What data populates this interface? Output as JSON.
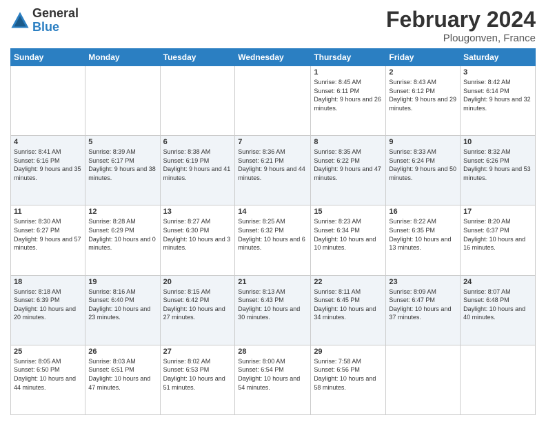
{
  "logo": {
    "general": "General",
    "blue": "Blue"
  },
  "title": {
    "month_year": "February 2024",
    "location": "Plougonven, France"
  },
  "days_header": [
    "Sunday",
    "Monday",
    "Tuesday",
    "Wednesday",
    "Thursday",
    "Friday",
    "Saturday"
  ],
  "weeks": [
    [
      {
        "day": "",
        "info": ""
      },
      {
        "day": "",
        "info": ""
      },
      {
        "day": "",
        "info": ""
      },
      {
        "day": "",
        "info": ""
      },
      {
        "day": "1",
        "info": "Sunrise: 8:45 AM\nSunset: 6:11 PM\nDaylight: 9 hours and 26 minutes."
      },
      {
        "day": "2",
        "info": "Sunrise: 8:43 AM\nSunset: 6:12 PM\nDaylight: 9 hours and 29 minutes."
      },
      {
        "day": "3",
        "info": "Sunrise: 8:42 AM\nSunset: 6:14 PM\nDaylight: 9 hours and 32 minutes."
      }
    ],
    [
      {
        "day": "4",
        "info": "Sunrise: 8:41 AM\nSunset: 6:16 PM\nDaylight: 9 hours and 35 minutes."
      },
      {
        "day": "5",
        "info": "Sunrise: 8:39 AM\nSunset: 6:17 PM\nDaylight: 9 hours and 38 minutes."
      },
      {
        "day": "6",
        "info": "Sunrise: 8:38 AM\nSunset: 6:19 PM\nDaylight: 9 hours and 41 minutes."
      },
      {
        "day": "7",
        "info": "Sunrise: 8:36 AM\nSunset: 6:21 PM\nDaylight: 9 hours and 44 minutes."
      },
      {
        "day": "8",
        "info": "Sunrise: 8:35 AM\nSunset: 6:22 PM\nDaylight: 9 hours and 47 minutes."
      },
      {
        "day": "9",
        "info": "Sunrise: 8:33 AM\nSunset: 6:24 PM\nDaylight: 9 hours and 50 minutes."
      },
      {
        "day": "10",
        "info": "Sunrise: 8:32 AM\nSunset: 6:26 PM\nDaylight: 9 hours and 53 minutes."
      }
    ],
    [
      {
        "day": "11",
        "info": "Sunrise: 8:30 AM\nSunset: 6:27 PM\nDaylight: 9 hours and 57 minutes."
      },
      {
        "day": "12",
        "info": "Sunrise: 8:28 AM\nSunset: 6:29 PM\nDaylight: 10 hours and 0 minutes."
      },
      {
        "day": "13",
        "info": "Sunrise: 8:27 AM\nSunset: 6:30 PM\nDaylight: 10 hours and 3 minutes."
      },
      {
        "day": "14",
        "info": "Sunrise: 8:25 AM\nSunset: 6:32 PM\nDaylight: 10 hours and 6 minutes."
      },
      {
        "day": "15",
        "info": "Sunrise: 8:23 AM\nSunset: 6:34 PM\nDaylight: 10 hours and 10 minutes."
      },
      {
        "day": "16",
        "info": "Sunrise: 8:22 AM\nSunset: 6:35 PM\nDaylight: 10 hours and 13 minutes."
      },
      {
        "day": "17",
        "info": "Sunrise: 8:20 AM\nSunset: 6:37 PM\nDaylight: 10 hours and 16 minutes."
      }
    ],
    [
      {
        "day": "18",
        "info": "Sunrise: 8:18 AM\nSunset: 6:39 PM\nDaylight: 10 hours and 20 minutes."
      },
      {
        "day": "19",
        "info": "Sunrise: 8:16 AM\nSunset: 6:40 PM\nDaylight: 10 hours and 23 minutes."
      },
      {
        "day": "20",
        "info": "Sunrise: 8:15 AM\nSunset: 6:42 PM\nDaylight: 10 hours and 27 minutes."
      },
      {
        "day": "21",
        "info": "Sunrise: 8:13 AM\nSunset: 6:43 PM\nDaylight: 10 hours and 30 minutes."
      },
      {
        "day": "22",
        "info": "Sunrise: 8:11 AM\nSunset: 6:45 PM\nDaylight: 10 hours and 34 minutes."
      },
      {
        "day": "23",
        "info": "Sunrise: 8:09 AM\nSunset: 6:47 PM\nDaylight: 10 hours and 37 minutes."
      },
      {
        "day": "24",
        "info": "Sunrise: 8:07 AM\nSunset: 6:48 PM\nDaylight: 10 hours and 40 minutes."
      }
    ],
    [
      {
        "day": "25",
        "info": "Sunrise: 8:05 AM\nSunset: 6:50 PM\nDaylight: 10 hours and 44 minutes."
      },
      {
        "day": "26",
        "info": "Sunrise: 8:03 AM\nSunset: 6:51 PM\nDaylight: 10 hours and 47 minutes."
      },
      {
        "day": "27",
        "info": "Sunrise: 8:02 AM\nSunset: 6:53 PM\nDaylight: 10 hours and 51 minutes."
      },
      {
        "day": "28",
        "info": "Sunrise: 8:00 AM\nSunset: 6:54 PM\nDaylight: 10 hours and 54 minutes."
      },
      {
        "day": "29",
        "info": "Sunrise: 7:58 AM\nSunset: 6:56 PM\nDaylight: 10 hours and 58 minutes."
      },
      {
        "day": "",
        "info": ""
      },
      {
        "day": "",
        "info": ""
      }
    ]
  ]
}
